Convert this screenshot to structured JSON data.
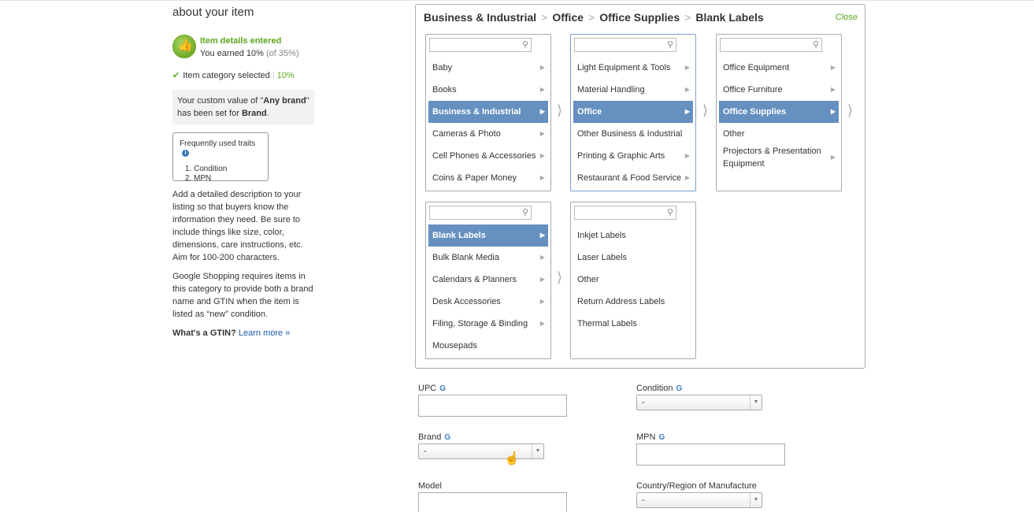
{
  "sidebar": {
    "heading": "about your item",
    "earned_title": "Item details entered",
    "earned_text": "You earned 10%",
    "earned_muted": "(of 35%)",
    "category_selected": "Item category selected",
    "category_pct": "10%",
    "custom_pre": "Your custom value of \"",
    "custom_value": "Any brand",
    "custom_mid": "\" has been set for ",
    "custom_field": "Brand",
    "custom_end": ".",
    "traits_title": "Frequently used traits",
    "traits": [
      "Condition",
      "MPN"
    ],
    "desc1": "Add a detailed description to your listing so that buyers know the information they need. Be sure to include things like size, color, dimensions, care instructions, etc. Aim for 100-200 characters.",
    "desc2": "Google Shopping requires items in this category to provide both a brand name and GTIN when the item is listed as “new” condition.",
    "gtin_q": "What's a GTIN?",
    "gtin_link": "Learn more »"
  },
  "panel": {
    "crumbs": [
      "Business & Industrial",
      "Office",
      "Office Supplies",
      "Blank Labels"
    ],
    "close": "Close",
    "col1": [
      "Baby",
      "Books",
      "Business & Industrial",
      "Cameras & Photo",
      "Cell Phones & Accessories",
      "Coins & Paper Money"
    ],
    "col2": [
      "Light Equipment & Tools",
      "Material Handling",
      "Office",
      "Other Business & Industrial",
      "Printing & Graphic Arts",
      "Restaurant & Food Service"
    ],
    "col3": [
      "Office Equipment",
      "Office Furniture",
      "Office Supplies",
      "Other",
      "Projectors & Presentation Equipment"
    ],
    "col4": [
      "Blank Labels",
      "Bulk Blank Media",
      "Calendars & Planners",
      "Desk Accessories",
      "Filing, Storage & Binding",
      "Mousepads"
    ],
    "col5": [
      "Inkjet Labels",
      "Laser Labels",
      "Other",
      "Return Address Labels",
      "Thermal Labels"
    ]
  },
  "form": {
    "upc": "UPC",
    "condition": "Condition",
    "condition_value": "-",
    "brand": "Brand",
    "brand_value": "-",
    "mpn": "MPN",
    "model": "Model",
    "country": "Country/Region of Manufacture",
    "country_value": "-"
  },
  "colors": {
    "accent_green": "#5ba71b",
    "selected_blue": "#6590c0",
    "link_blue": "#1a5aa8"
  }
}
